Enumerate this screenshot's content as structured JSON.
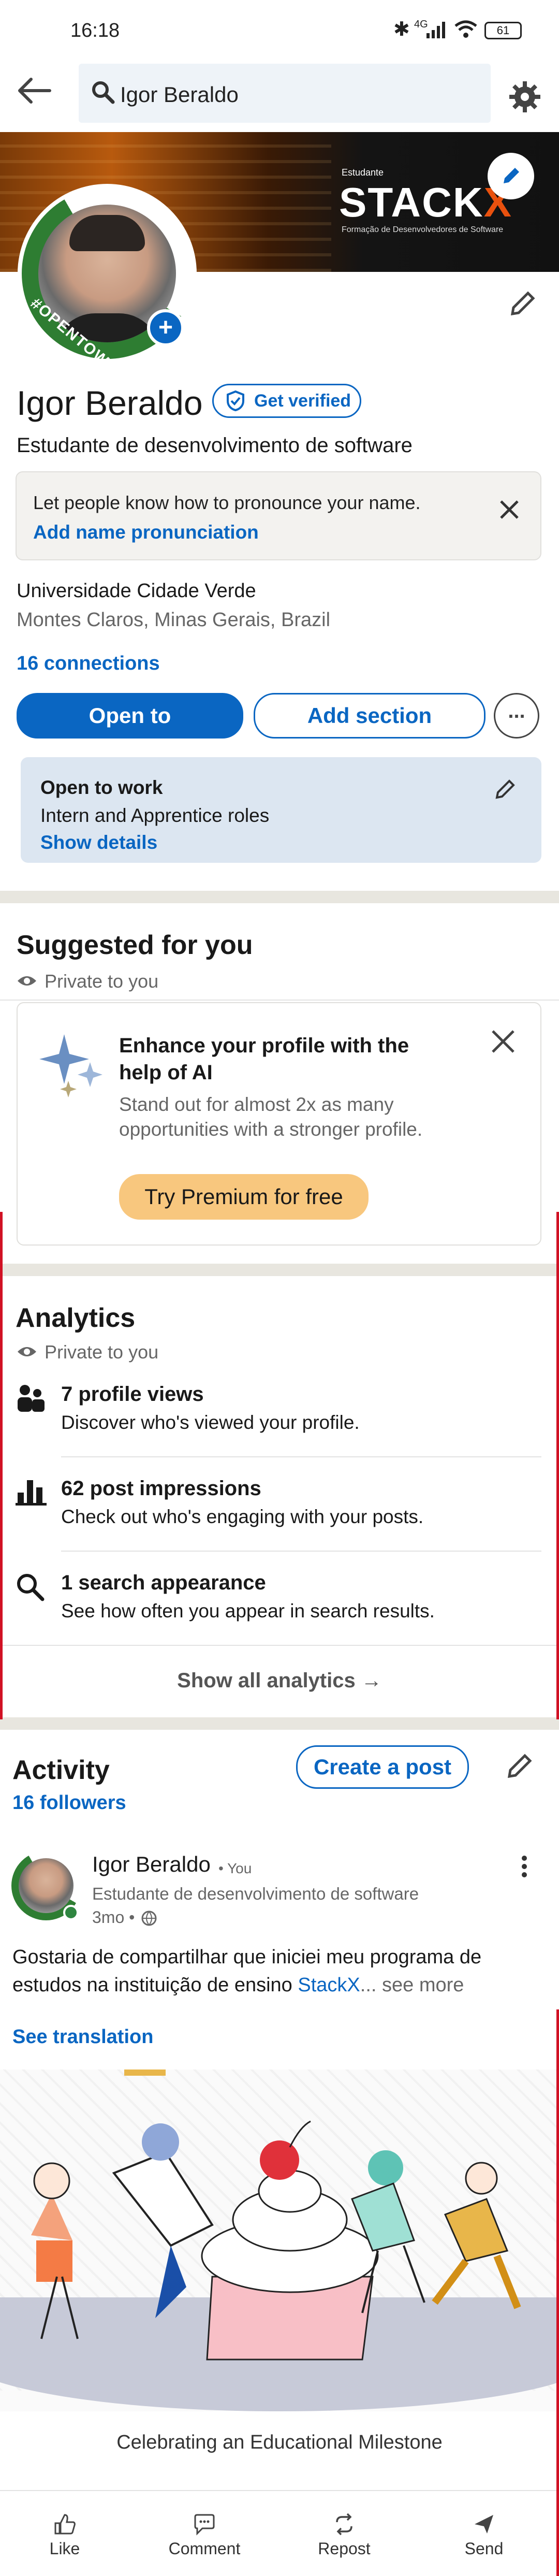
{
  "status_bar": {
    "time": "16:18",
    "network": "4G",
    "battery": "61"
  },
  "search": {
    "query": "Igor Beraldo"
  },
  "banner": {
    "tag_small": "Estudante",
    "brand_a": "STACK",
    "brand_b": "X",
    "subtitle": "Formação de Desenvolvedores de Software"
  },
  "profile": {
    "name": "Igor Beraldo",
    "verify_label": "Get verified",
    "headline": "Estudante de desenvolvimento de software",
    "opentowork_ring": "#OPENTOWORK",
    "pronounce_text": "Let people know how to pronounce your name.",
    "pronounce_link": "Add name pronunciation",
    "school": "Universidade Cidade Verde",
    "location": "Montes Claros, Minas Gerais, Brazil",
    "connections": "16 connections",
    "open_to_btn": "Open to",
    "add_section_btn": "Add section",
    "otw_title": "Open to work",
    "otw_roles": "Intern and Apprentice roles",
    "otw_details": "Show details"
  },
  "suggested": {
    "title": "Suggested for you",
    "private": "Private to you",
    "card_title": "Enhance your profile with the help of AI",
    "card_body": "Stand out for almost 2x as many opportunities with a stronger profile.",
    "cta": "Try Premium for free"
  },
  "analytics": {
    "title": "Analytics",
    "private": "Private to you",
    "items": [
      {
        "title": "7 profile views",
        "desc": "Discover who's viewed your profile."
      },
      {
        "title": "62 post impressions",
        "desc": "Check out who's engaging with your posts."
      },
      {
        "title": "1 search appearance",
        "desc": "See how often you appear in search results."
      }
    ],
    "show_all": "Show all analytics →"
  },
  "activity": {
    "title": "Activity",
    "followers": "16 followers",
    "create_post": "Create a post",
    "post": {
      "author": "Igor Beraldo",
      "badge": "• You",
      "headline": "Estudante de desenvolvimento de software",
      "time": "3mo •",
      "text": "Gostaria de compartilhar que iniciei meu programa de estudos na instituição de ensino",
      "mention": "StackX",
      "ellipsis": "...",
      "see_more": "see more",
      "translate": "See translation",
      "image_caption": "Celebrating an Educational Milestone"
    }
  },
  "actions": {
    "like": "Like",
    "comment": "Comment",
    "repost": "Repost",
    "send": "Send"
  },
  "colors": {
    "brand_blue": "#0a66c2",
    "open_to_work_green": "#2e7d32",
    "premium_gold": "#f8c77e",
    "otw_card_bg": "#dce6f1"
  }
}
